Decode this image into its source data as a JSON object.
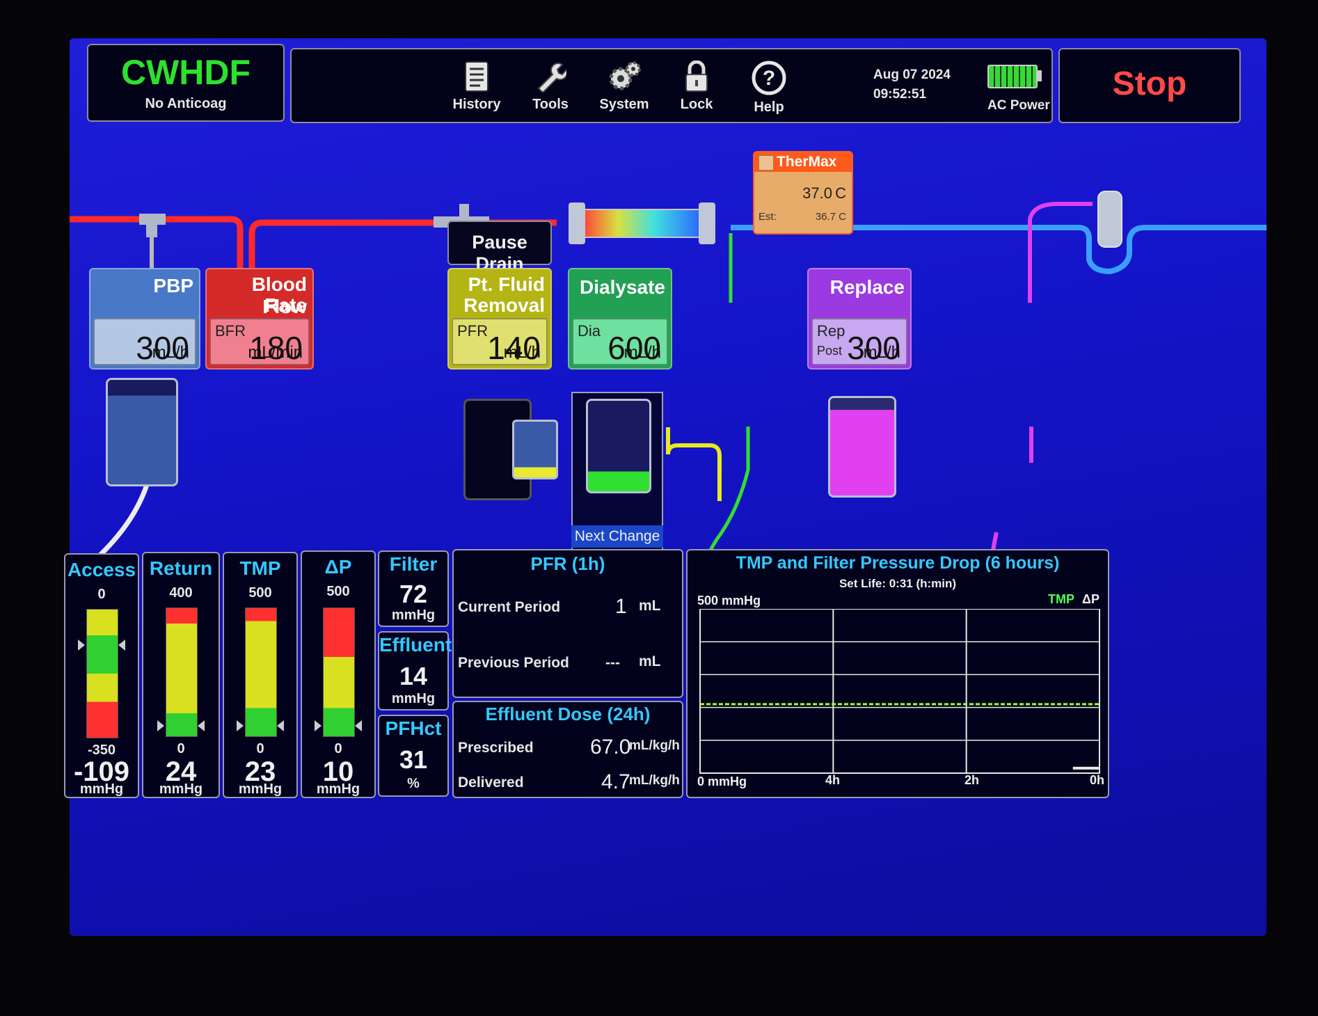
{
  "mode": {
    "title": "CWHDF",
    "subtitle": "No Anticoag"
  },
  "toolbar": {
    "history": "History",
    "tools": "Tools",
    "system": "System",
    "lock": "Lock",
    "help": "Help",
    "date": "Aug 07 2024",
    "time": "09:52:51",
    "power": "AC Power"
  },
  "stop_label": "Stop",
  "thermax": {
    "title": "TherMax",
    "temp": "37.0",
    "temp_unit": "C",
    "est_label": "Est:",
    "est_value": "36.7 C"
  },
  "pause_drain_label": "Pause Drain",
  "next_change_label": "Next Change",
  "pumps": {
    "pbp": {
      "title": "PBP",
      "value": "300",
      "unit": "mL/h"
    },
    "bfr": {
      "title": "Blood Flow Rate",
      "title_1": "Blood Flow",
      "title_2": "Rate",
      "code": "BFR",
      "value": "180",
      "unit": "mL/min"
    },
    "pfr": {
      "title_1": "Pt. Fluid",
      "title_2": "Removal",
      "code": "PFR",
      "value": "140",
      "unit": "mL/h"
    },
    "dia": {
      "title": "Dialysate",
      "code": "Dia",
      "value": "600",
      "unit": "mL/h"
    },
    "rep": {
      "title": "Replace",
      "code": "Rep",
      "mode": "Post",
      "value": "300",
      "unit": "mL/h"
    }
  },
  "pressures": [
    {
      "title": "Access",
      "top": "0",
      "bottom": "-350",
      "value": "-109",
      "unit": "mmHg",
      "color": "#ff3030"
    },
    {
      "title": "Return",
      "top": "400",
      "bottom": "0",
      "value": "24",
      "unit": "mmHg",
      "color": "#ff3030"
    },
    {
      "title": "TMP",
      "top": "500",
      "bottom": "0",
      "value": "23",
      "unit": "mmHg",
      "color": "#ff3030"
    },
    {
      "title": "ΔP",
      "top": "500",
      "bottom": "0",
      "value": "10",
      "unit": "mmHg",
      "color": "#ff3030"
    }
  ],
  "filter": {
    "title": "Filter",
    "value": "72",
    "unit": "mmHg"
  },
  "effluent": {
    "title": "Effluent",
    "value": "14",
    "unit": "mmHg"
  },
  "pfhct": {
    "title": "PFHct",
    "value": "31",
    "unit": "%"
  },
  "pfr_panel": {
    "title": "PFR (1h)",
    "current_label": "Current Period",
    "current_value": "1",
    "current_unit": "mL",
    "previous_label": "Previous Period",
    "previous_value": "---",
    "previous_unit": "mL"
  },
  "dose_panel": {
    "title": "Effluent Dose (24h)",
    "prescribed_label": "Prescribed",
    "prescribed_value": "67.0",
    "prescribed_unit": "mL/kg/h",
    "delivered_label": "Delivered",
    "delivered_value": "4.7",
    "delivered_unit": "mL/kg/h"
  },
  "chart_data": {
    "type": "line",
    "title": "TMP and Filter Pressure Drop (6 hours)",
    "subtitle": "Set Life: 0:31 (h:min)",
    "ylabel_top": "500 mmHg",
    "ylabel_bottom": "0 mmHg",
    "ylim": [
      0,
      500
    ],
    "x_tick_labels": [
      "4h",
      "2h",
      "0h"
    ],
    "legend": [
      "TMP",
      "ΔP"
    ],
    "legend_position": "top-right",
    "grid": true,
    "series": [
      {
        "name": "TMP",
        "color": "#a0ff30",
        "x": [
          6,
          0
        ],
        "y": [
          210,
          210
        ]
      },
      {
        "name": "ΔP",
        "color": "#e8e8e8",
        "x": [
          0.4,
          0
        ],
        "y": [
          15,
          15
        ]
      }
    ]
  },
  "colors": {
    "blood_line": "#ff2020",
    "return_line": "#3aa0ff",
    "effluent_line": "#e6ea20",
    "dialysate_line": "#30e030",
    "replacement_line": "#e040f0",
    "title_accent": "#35c8ff"
  }
}
